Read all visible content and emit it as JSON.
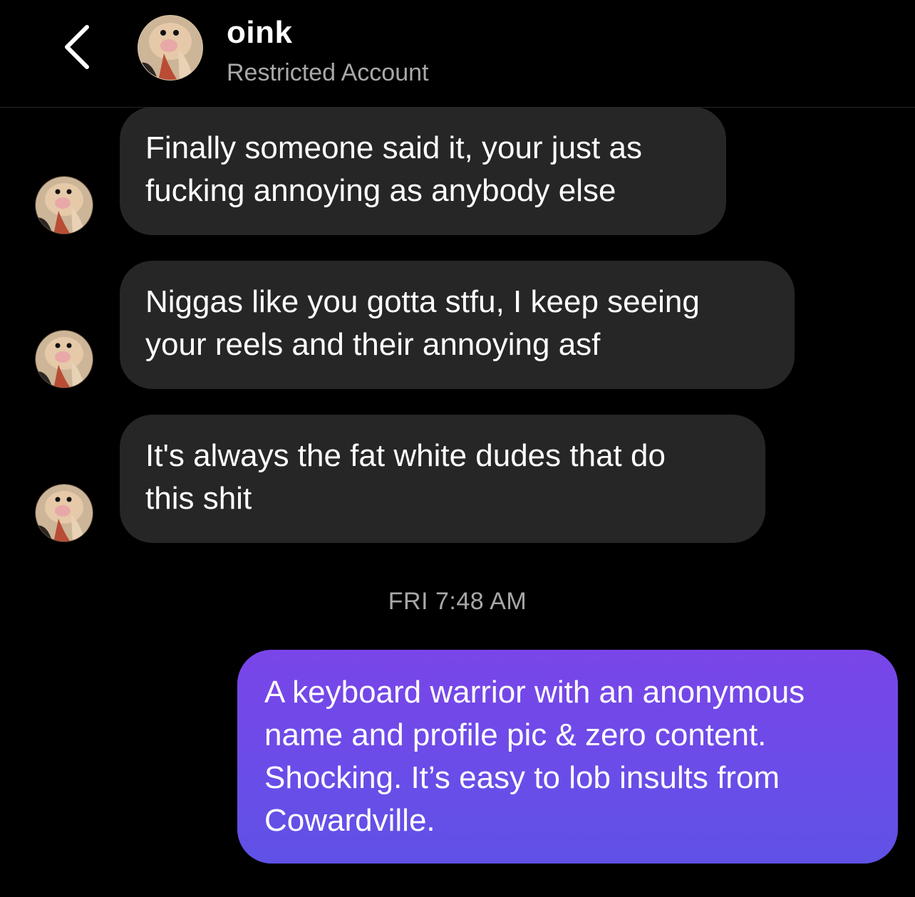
{
  "header": {
    "title": "oink",
    "subtitle": "Restricted Account",
    "back_icon": "chevron-left-icon",
    "avatar": "pig-avatar"
  },
  "messages": [
    {
      "sender": "incoming",
      "lines": [
        "Finally someone said it, your just as",
        "fucking annoying as anybody else"
      ]
    },
    {
      "sender": "incoming",
      "lines": [
        "Niggas like you gotta stfu, I keep seeing",
        "your reels and their annoying asf"
      ]
    },
    {
      "sender": "incoming",
      "lines": [
        "It's always the fat white dudes that do",
        "this shit"
      ]
    }
  ],
  "timestamp": "FRI 7:48 AM",
  "outgoing": {
    "lines": [
      "A keyboard warrior with an anonymous",
      "name and profile pic & zero content.",
      "Shocking. It’s easy to lob insults from",
      "Cowardville."
    ]
  },
  "colors": {
    "background": "#000000",
    "incoming_bubble": "#262626",
    "outgoing_gradient_top": "#7a45e8",
    "outgoing_gradient_bottom": "#5f52e6",
    "secondary_text": "#a8a8a8"
  }
}
